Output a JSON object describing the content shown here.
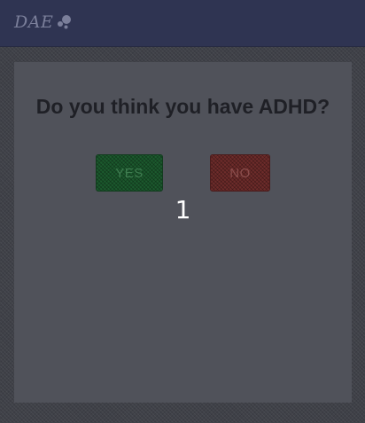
{
  "header": {
    "brand": "DAE",
    "brand_icon": "bubbles-logo-icon"
  },
  "poll": {
    "question": "Do you think you have ADHD?",
    "yes_label": "YES",
    "no_label": "NO",
    "count": "1"
  },
  "colors": {
    "topbar": "#2f3452",
    "panel": "#50525a",
    "yes_button": "#1c5a2e",
    "no_button": "#6e2c2b"
  }
}
